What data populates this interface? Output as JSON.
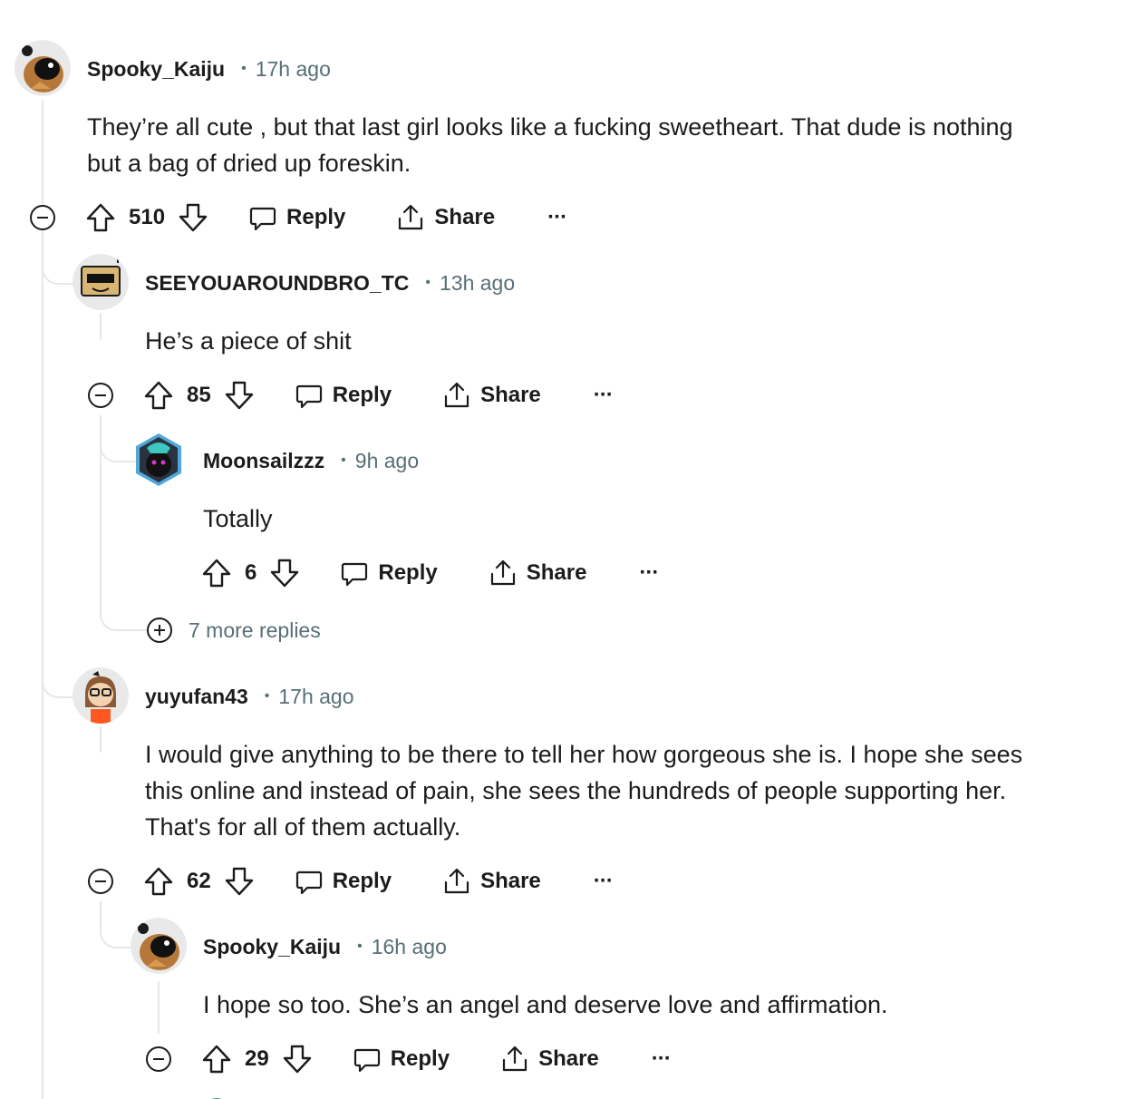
{
  "comments": [
    {
      "username": "Spooky_Kaiju",
      "time": "17h ago",
      "body": [
        "They’re all cute , but that last girl looks like a fucking sweetheart. That dude is nothing",
        "but a bag of dried up foreskin."
      ],
      "score": "510",
      "reply_label": "Reply",
      "share_label": "Share",
      "more_label": "···"
    },
    {
      "username": "SEEYOUAROUNDBRO_TC",
      "time": "13h ago",
      "body": [
        "He’s a piece of shit"
      ],
      "score": "85",
      "reply_label": "Reply",
      "share_label": "Share",
      "more_label": "···"
    },
    {
      "username": "Moonsailzzz",
      "time": "9h ago",
      "body": [
        "Totally"
      ],
      "score": "6",
      "reply_label": "Reply",
      "share_label": "Share",
      "more_label": "···"
    },
    {
      "username": "yuyufan43",
      "time": "17h ago",
      "body": [
        "I would give anything to be there to tell her how gorgeous she is. I hope she sees",
        "this online and instead of pain, she sees the hundreds of people supporting her.",
        "That's for all of them actually."
      ],
      "score": "62",
      "reply_label": "Reply",
      "share_label": "Share",
      "more_label": "···"
    },
    {
      "username": "Spooky_Kaiju",
      "time": "16h ago",
      "body": [
        "I hope so too. She’s an angel and deserve love and affirmation."
      ],
      "score": "29",
      "reply_label": "Reply",
      "share_label": "Share",
      "more_label": "···"
    }
  ],
  "more_replies_label": "7 more replies",
  "separator": "•",
  "colors": {
    "text": "#1c1c1c",
    "muted": "#576f76",
    "thread": "#e5e8ea"
  }
}
